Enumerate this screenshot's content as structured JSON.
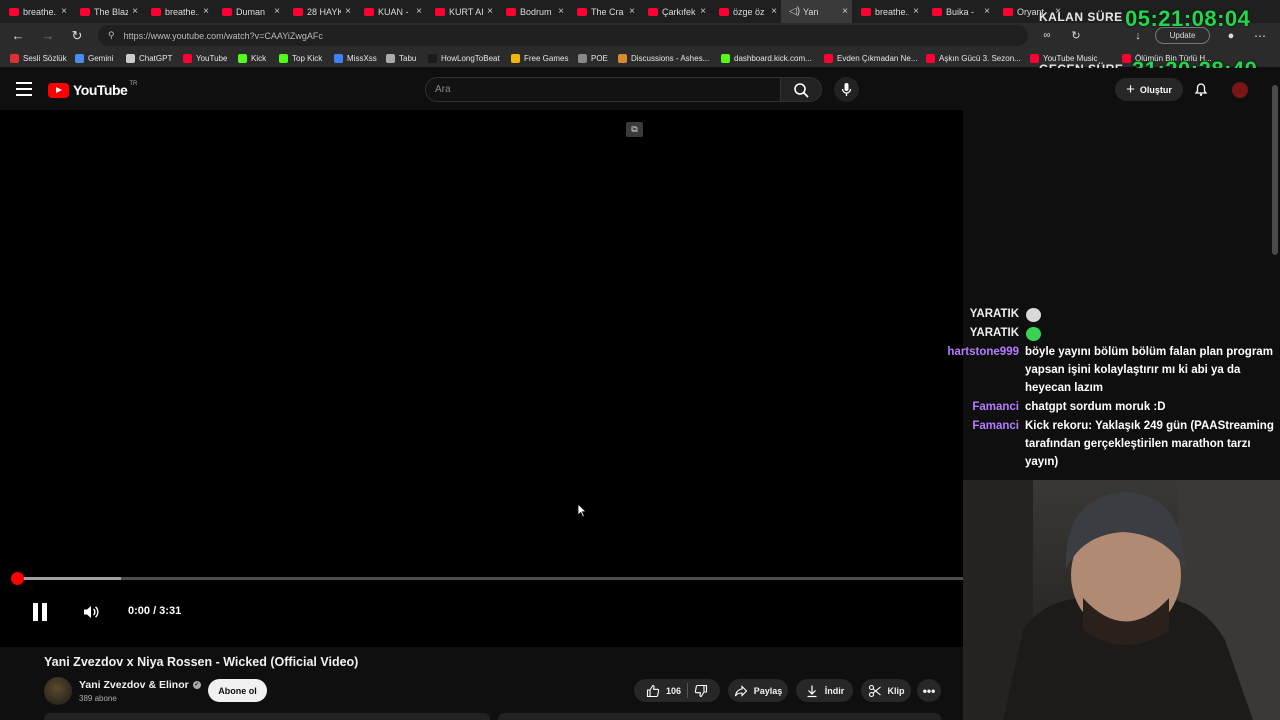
{
  "browser": {
    "tabs": [
      {
        "label": "breathe...",
        "active": false
      },
      {
        "label": "The Blaz",
        "active": false
      },
      {
        "label": "breathe...",
        "active": false
      },
      {
        "label": "Duman",
        "active": false
      },
      {
        "label": "28 HAYK",
        "active": false
      },
      {
        "label": "KUAN - ",
        "active": false
      },
      {
        "label": "KURT AI",
        "active": false
      },
      {
        "label": "Bodrum",
        "active": false
      },
      {
        "label": "The Cra",
        "active": false
      },
      {
        "label": "Çarkıfek",
        "active": false
      },
      {
        "label": "özge öz",
        "active": false
      },
      {
        "label": "Yan",
        "active": true
      },
      {
        "label": "breathe...",
        "active": false
      },
      {
        "label": "Buika - ",
        "active": false
      },
      {
        "label": "Oryant",
        "active": false
      }
    ],
    "url": "https://www.youtube.com/watch?v=CAAYiZwgAFc",
    "update_label": "Update",
    "bookmarks": [
      {
        "label": "Sesli Sözlük",
        "color": "#e03131"
      },
      {
        "label": "Gemini",
        "color": "#4c8bf5"
      },
      {
        "label": "ChatGPT",
        "color": "#cccccc"
      },
      {
        "label": "YouTube",
        "color": "#ff0033"
      },
      {
        "label": "Kick",
        "color": "#53fc18"
      },
      {
        "label": "Top Kick",
        "color": "#53fc18"
      },
      {
        "label": "MissXss",
        "color": "#3b82f6"
      },
      {
        "label": "Tabu",
        "color": "#aaaaaa"
      },
      {
        "label": "HowLongToBeat",
        "color": "#1a1a1a"
      },
      {
        "label": "Free Games",
        "color": "#f2b705"
      },
      {
        "label": "POE",
        "color": "#888888"
      },
      {
        "label": "Discussions - Ashes...",
        "color": "#d98b2b"
      },
      {
        "label": "dashboard.kick.com...",
        "color": "#53fc18"
      },
      {
        "label": "Evden Çıkmadan Ne...",
        "color": "#ff0033"
      },
      {
        "label": "Aşkın Gücü 3. Sezon...",
        "color": "#ff0033"
      },
      {
        "label": "YouTube Music",
        "color": "#ff0033"
      },
      {
        "label": "Ölümün Bin Türlü H...",
        "color": "#ff0033"
      }
    ]
  },
  "youtube": {
    "logo_text": "YouTube",
    "region": "TR",
    "search_placeholder": "Ara",
    "create_label": "Oluştur"
  },
  "timers": {
    "remaining_label": "KALAN SÜRE",
    "remaining_value": "05:21:08:04",
    "elapsed_label": "GEÇEN SÜRE",
    "elapsed_value": "31:20:28:40"
  },
  "player": {
    "time_display": "0:00 / 3:31",
    "played_fraction": 0.0,
    "buffered_fraction": 0.11
  },
  "video": {
    "title": "Yani Zvezdov x Niya Rossen - Wicked (Official Video)",
    "channel": "Yani Zvezdov & Elinor",
    "subscribers": "389 abone",
    "subscribe_label": "Abone ol",
    "like_count": "106",
    "share_label": "Paylaş",
    "download_label": "İndir",
    "clip_label": "Klip"
  },
  "chat": [
    {
      "user": "YARATIK",
      "user_color": "#f0f0f0",
      "message": "",
      "emote": "ghost-emote"
    },
    {
      "user": "YARATIK",
      "user_color": "#f0f0f0",
      "message": "",
      "emote": "green-blob-emote"
    },
    {
      "user": "hartstone999",
      "user_color": "#b57cff",
      "message": "böyle yayını bölüm bölüm falan plan program yapsan işini kolaylaştırır mı ki abi ya da heyecan lazım"
    },
    {
      "user": "Famanci",
      "user_color": "#b57cff",
      "message": "chatgpt sordum moruk :D"
    },
    {
      "user": "Famanci",
      "user_color": "#b57cff",
      "message": "Kick rekoru: Yaklaşık 249 gün (PAAStreaming tarafından gerçekleştirilen marathon tarzı yayın)"
    }
  ]
}
